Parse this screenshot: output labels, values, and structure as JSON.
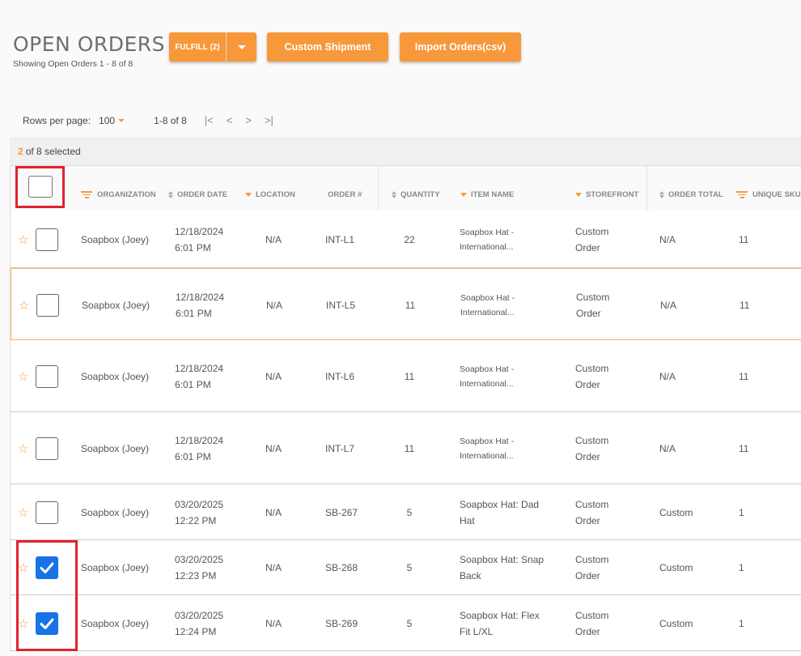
{
  "header": {
    "title": "OPEN ORDERS",
    "subtitle": "Showing Open Orders 1 - 8 of 8",
    "fulfill_label": "FULFILL (2)",
    "custom_shipment_label": "Custom Shipment",
    "import_label": "Import Orders(csv)"
  },
  "pager": {
    "rows_per_page_label": "Rows per page:",
    "rows_per_page_value": "100",
    "range": "1-8 of 8",
    "first": "|<",
    "prev": "<",
    "next": ">",
    "last": ">|"
  },
  "selection": {
    "count": "2",
    "text": "of 8 selected"
  },
  "columns": {
    "organization": "ORGANIZATION",
    "order_date": "ORDER DATE",
    "location": "LOCATION",
    "order_num": "ORDER #",
    "quantity": "QUANTITY",
    "item_name": "ITEM NAME",
    "storefront": "STOREFRONT",
    "order_total": "ORDER TOTAL",
    "unique_sku": "UNIQUE SKU"
  },
  "rows": [
    {
      "org": "Soapbox (Joey)",
      "date1": "12/18/2024",
      "date2": "6:01 PM",
      "location": "N/A",
      "order": "INT-L1",
      "qty": "22",
      "item1": "Soapbox Hat -",
      "item2": "International...",
      "store1": "Custom",
      "store2": "Order",
      "total": "N/A",
      "sku": "11",
      "checked": false
    },
    {
      "org": "Soapbox (Joey)",
      "date1": "12/18/2024",
      "date2": "6:01 PM",
      "location": "N/A",
      "order": "INT-L5",
      "qty": "11",
      "item1": "Soapbox Hat -",
      "item2": "International...",
      "store1": "Custom",
      "store2": "Order",
      "total": "N/A",
      "sku": "11",
      "checked": false
    },
    {
      "org": "Soapbox (Joey)",
      "date1": "12/18/2024",
      "date2": "6:01 PM",
      "location": "N/A",
      "order": "INT-L6",
      "qty": "11",
      "item1": "Soapbox Hat -",
      "item2": "International...",
      "store1": "Custom",
      "store2": "Order",
      "total": "N/A",
      "sku": "11",
      "checked": false
    },
    {
      "org": "Soapbox (Joey)",
      "date1": "12/18/2024",
      "date2": "6:01 PM",
      "location": "N/A",
      "order": "INT-L7",
      "qty": "11",
      "item1": "Soapbox Hat -",
      "item2": "International...",
      "store1": "Custom",
      "store2": "Order",
      "total": "N/A",
      "sku": "11",
      "checked": false
    },
    {
      "org": "Soapbox (Joey)",
      "date1": "03/20/2025",
      "date2": "12:22 PM",
      "location": "N/A",
      "order": "SB-267",
      "qty": "5",
      "item1": "Soapbox Hat: Dad",
      "item2": "Hat",
      "store1": "Custom",
      "store2": "Order",
      "total": "Custom",
      "sku": "1",
      "checked": false
    },
    {
      "org": "Soapbox (Joey)",
      "date1": "03/20/2025",
      "date2": "12:23 PM",
      "location": "N/A",
      "order": "SB-268",
      "qty": "5",
      "item1": "Soapbox Hat: Snap",
      "item2": "Back",
      "store1": "Custom",
      "store2": "Order",
      "total": "Custom",
      "sku": "1",
      "checked": true
    },
    {
      "org": "Soapbox (Joey)",
      "date1": "03/20/2025",
      "date2": "12:24 PM",
      "location": "N/A",
      "order": "SB-269",
      "qty": "5",
      "item1": "Soapbox Hat: Flex",
      "item2": "Fit L/XL",
      "store1": "Custom",
      "store2": "Order",
      "total": "Custom",
      "sku": "1",
      "checked": true
    }
  ]
}
